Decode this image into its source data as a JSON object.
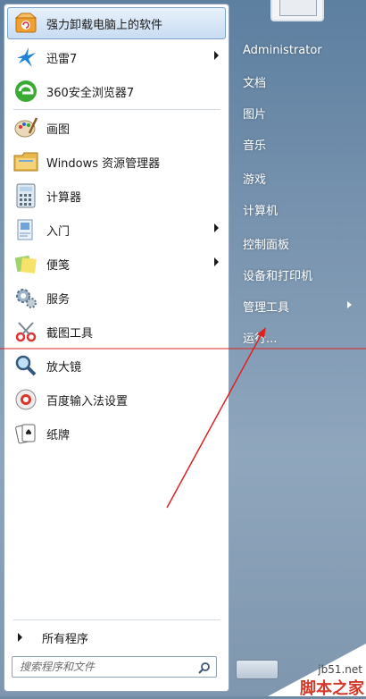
{
  "pinned": [
    {
      "label": "强力卸载电脑上的软件",
      "icon": "uninstall-box-icon"
    },
    {
      "label": "迅雷7",
      "icon": "thunder-bird-icon",
      "submenu": true
    },
    {
      "label": "360安全浏览器7",
      "icon": "browser-360-icon"
    }
  ],
  "recent": [
    {
      "label": "画图",
      "icon": "paint-palette-icon"
    },
    {
      "label": "Windows 资源管理器",
      "icon": "folder-explorer-icon"
    },
    {
      "label": "计算器",
      "icon": "calculator-icon"
    },
    {
      "label": "入门",
      "icon": "getting-started-icon",
      "submenu": true
    },
    {
      "label": "便笺",
      "icon": "sticky-notes-icon",
      "submenu": true
    },
    {
      "label": "服务",
      "icon": "services-gear-icon"
    },
    {
      "label": "截图工具",
      "icon": "snipping-tool-icon"
    },
    {
      "label": "放大镜",
      "icon": "magnifier-icon"
    },
    {
      "label": "百度输入法设置",
      "icon": "baidu-ime-icon"
    },
    {
      "label": "纸牌",
      "icon": "solitaire-cards-icon"
    }
  ],
  "all_programs": "所有程序",
  "search_placeholder": "搜索程序和文件",
  "right_items": [
    {
      "label": "Administrator"
    },
    {
      "label": "文档"
    },
    {
      "label": "图片"
    },
    {
      "label": "音乐"
    },
    {
      "label": "游戏"
    },
    {
      "label": "计算机"
    },
    {
      "label": "控制面板"
    },
    {
      "label": "设备和打印机"
    },
    {
      "label": "管理工具",
      "submenu": true
    },
    {
      "label": "运行..."
    }
  ],
  "watermark": {
    "url": "jb51.net",
    "text": "脚本之家"
  },
  "colors": {
    "accent_line": "#e02020",
    "menu_blue": "#5d7fa0"
  }
}
